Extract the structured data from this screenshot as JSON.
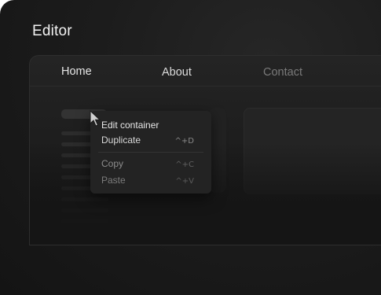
{
  "editor": {
    "title": "Editor"
  },
  "preview": {
    "nav": {
      "home": "Home",
      "about": "About",
      "contact": "Contact"
    }
  },
  "context_menu": {
    "items": [
      {
        "label": "Edit container",
        "shortcut": ""
      },
      {
        "label": "Duplicate",
        "shortcut": "^+D"
      },
      {
        "label": "Copy",
        "shortcut": "^+C"
      },
      {
        "label": "Paste",
        "shortcut": "^+V"
      }
    ]
  },
  "icons": {
    "cursor": "mouse-pointer-icon"
  },
  "colors": {
    "background": "#1c1c1c",
    "text_primary": "#f2f2f2",
    "text_muted": "#7a7a7a",
    "menu_background": "#232323"
  }
}
